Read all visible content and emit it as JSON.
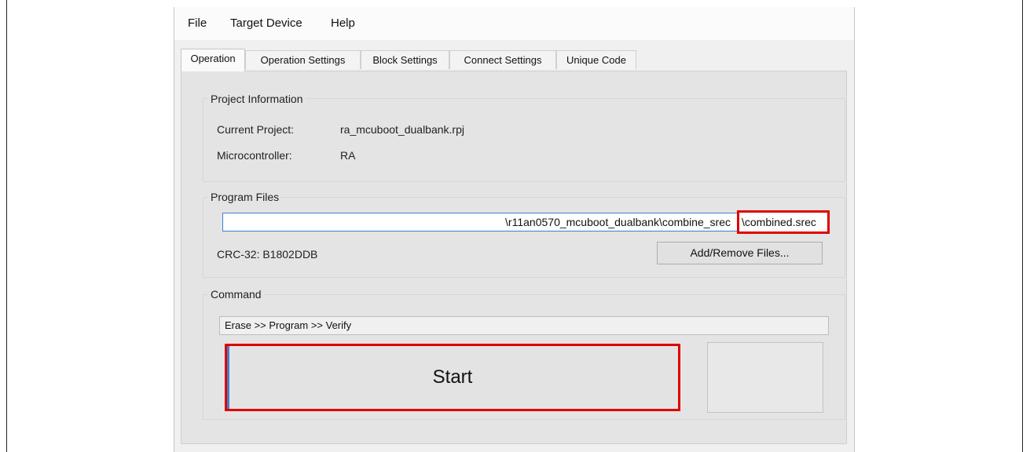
{
  "menu": {
    "file": "File",
    "target_device": "Target Device",
    "help": "Help"
  },
  "tabs": [
    {
      "label": "Operation",
      "active": true
    },
    {
      "label": "Operation Settings"
    },
    {
      "label": "Block Settings"
    },
    {
      "label": "Connect Settings"
    },
    {
      "label": "Unique Code"
    }
  ],
  "project_info": {
    "title": "Project Information",
    "current_project_label": "Current Project:",
    "current_project_value": "ra_mcuboot_dualbank.rpj",
    "microcontroller_label": "Microcontroller:",
    "microcontroller_value": "RA"
  },
  "program_files": {
    "title": "Program Files",
    "path_visible": "\\r11an0570_mcuboot_dualbank\\combine_srec",
    "path_highlighted": "\\combined.srec",
    "crc": "CRC-32: B1802DDB",
    "add_remove_label": "Add/Remove Files..."
  },
  "command": {
    "title": "Command",
    "sequence": "Erase >> Program >> Verify",
    "start_label": "Start"
  },
  "colors": {
    "highlight": "#e00000",
    "focus_blue": "#3d7fd1",
    "panel_bg": "#e4e4e4"
  }
}
